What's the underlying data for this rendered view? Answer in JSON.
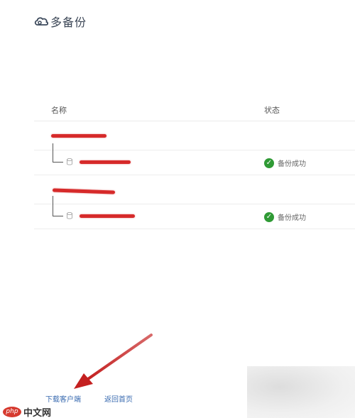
{
  "brand": {
    "name": "多备份"
  },
  "table": {
    "headers": {
      "name": "名称",
      "status": "状态"
    },
    "groups": [
      {
        "devices": [
          {
            "status": "备份成功"
          }
        ]
      },
      {
        "devices": [
          {
            "status": "备份成功"
          }
        ]
      }
    ]
  },
  "footer": {
    "download_client": "下载客户端",
    "back_home": "返回首页"
  },
  "watermark": {
    "logo": "php",
    "text": "中文网"
  },
  "colors": {
    "success": "#2f9a35",
    "link": "#3a6bb0",
    "annotation": "#c92a2a",
    "redaction": "#d62a2a"
  }
}
